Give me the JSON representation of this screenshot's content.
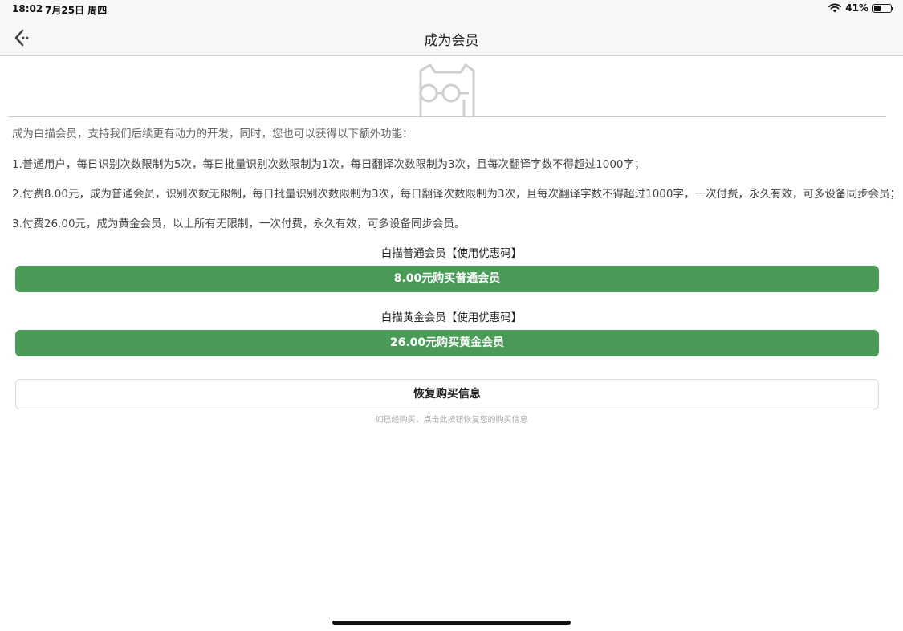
{
  "status_bar": {
    "time": "18:02",
    "date": "7月25日 周四",
    "battery_percent": "41%",
    "battery_level": 0.41
  },
  "nav": {
    "title": "成为会员",
    "back_icon": "chevron-left-icon"
  },
  "content": {
    "intro": "成为白描会员，支持我们后续更有动力的开发，同时，您也可以获得以下额外功能：",
    "features": [
      "1.普通用户，每日识别次数限制为5次，每日批量识别次数限制为1次，每日翻译次数限制为3次，且每次翻译字数不得超过1000字；",
      "2.付费8.00元，成为普通会员，识别次数无限制，每日批量识别次数限制为3次，每日翻译次数限制为3次，且每次翻译字数不得超过1000字，一次付费，永久有效，可多设备同步会员；",
      "3.付费26.00元，成为黄金会员，以上所有无限制，一次付费，永久有效，可多设备同步会员。"
    ]
  },
  "plans": {
    "normal": {
      "label": "白描普通会员【使用优惠码】",
      "button": "8.00元购买普通会员"
    },
    "gold": {
      "label": "白描黄金会员【使用优惠码】",
      "button": "26.00元购买黄金会员"
    }
  },
  "restore": {
    "button": "恢复购买信息",
    "hint": "如已经购买，点击此按钮恢复您的购买信息"
  },
  "colors": {
    "accent_green": "#4a9a58",
    "nav_background": "#f7f7f7"
  }
}
